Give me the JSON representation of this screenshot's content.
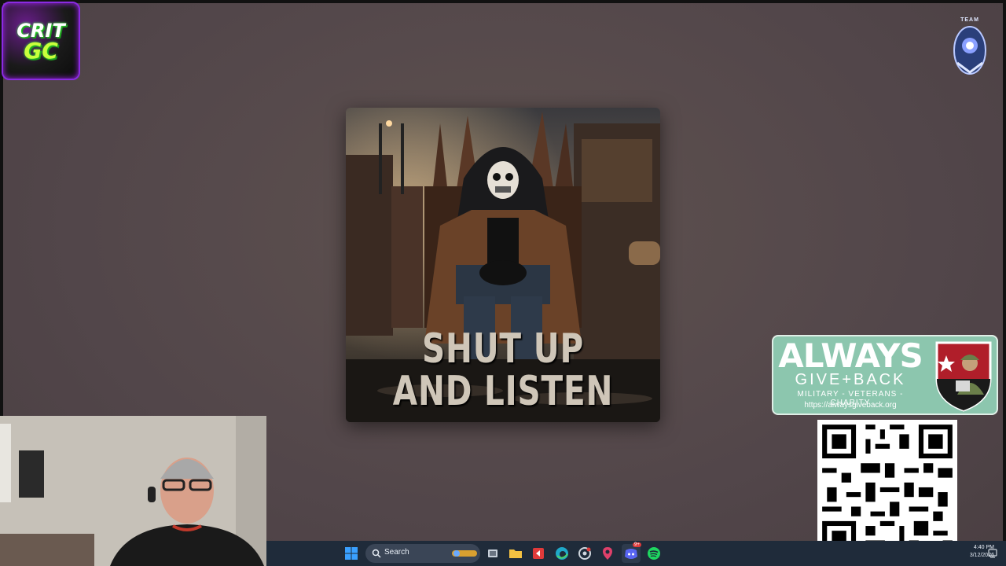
{
  "logo": {
    "line1": "CRIT",
    "line2": "GC"
  },
  "team_badge": {
    "label": "TEAM"
  },
  "album": {
    "title_line1": "SHUT UP",
    "title_line2": "AND LISTEN"
  },
  "charity": {
    "name": "ALWAYS",
    "tagline": "GIVE+BACK",
    "subtitle": "MILITARY - VETERANS - CHARITY",
    "url": "https://alwaysgiveback.org"
  },
  "taskbar": {
    "search_placeholder": "Search",
    "time": "4:40 PM",
    "date": "3/12/2026",
    "icons": [
      "windows-start-icon",
      "search-icon",
      "task-view-icon",
      "file-explorer-icon",
      "app-red-icon",
      "edge-browser-icon",
      "app-circle-icon",
      "map-pin-icon",
      "discord-icon",
      "spotify-icon",
      "notification-icon"
    ],
    "discord_badge": "9+"
  },
  "colors": {
    "background": "#55494b",
    "charity_green": "#8cc6ae",
    "taskbar": "#1f2b3a",
    "logo_purple": "#8a2be2",
    "logo_green": "#c8ff3c"
  }
}
